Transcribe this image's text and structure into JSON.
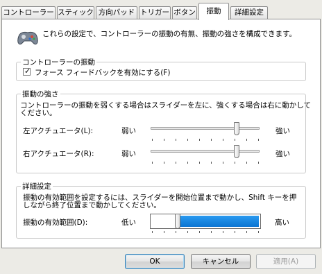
{
  "tabs": [
    {
      "label": "コントローラー"
    },
    {
      "label": "スティック"
    },
    {
      "label": "方向パッド"
    },
    {
      "label": "トリガー"
    },
    {
      "label": "ボタン"
    },
    {
      "label": "振動"
    },
    {
      "label": "詳細設定"
    }
  ],
  "active_tab": "振動",
  "intro": "これらの設定で、コントローラーの振動の有無、振動の強さを構成できます。",
  "vibration_group": {
    "title": "コントローラーの振動",
    "checkbox_label": "フォース フィードバックを有効にする(F)",
    "checked": true
  },
  "strength_group": {
    "title": "振動の強さ",
    "description_line1": "コントローラーの振動を弱くする場合はスライダーを左に、強くする場合は右に動かして",
    "description_line2": "ください。",
    "left_actuator": {
      "label": "左アクチュエータ(L):",
      "min_label": "弱い",
      "max_label": "強い",
      "value": 0.83
    },
    "right_actuator": {
      "label": "右アクチュエータ(R):",
      "min_label": "弱い",
      "max_label": "強い",
      "value": 0.83
    }
  },
  "advanced_group": {
    "title": "詳細設定",
    "description_line1": "振動の有効範囲を設定するには、スライダーを開始位置まで動かし、Shift キーを押",
    "description_line2": "しながら終了位置まで動かしてください。",
    "range_label": "振動の有効範囲(D):",
    "min_label": "低い",
    "max_label": "高い",
    "range_start": 0.25,
    "range_end": 1.0
  },
  "buttons": {
    "ok": "OK",
    "cancel": "キャンセル",
    "apply": "適用(A)"
  },
  "colors": {
    "accent": "#0a74d2",
    "dialog_bg": "#ecebe6",
    "panel_bg": "#ffffff"
  }
}
